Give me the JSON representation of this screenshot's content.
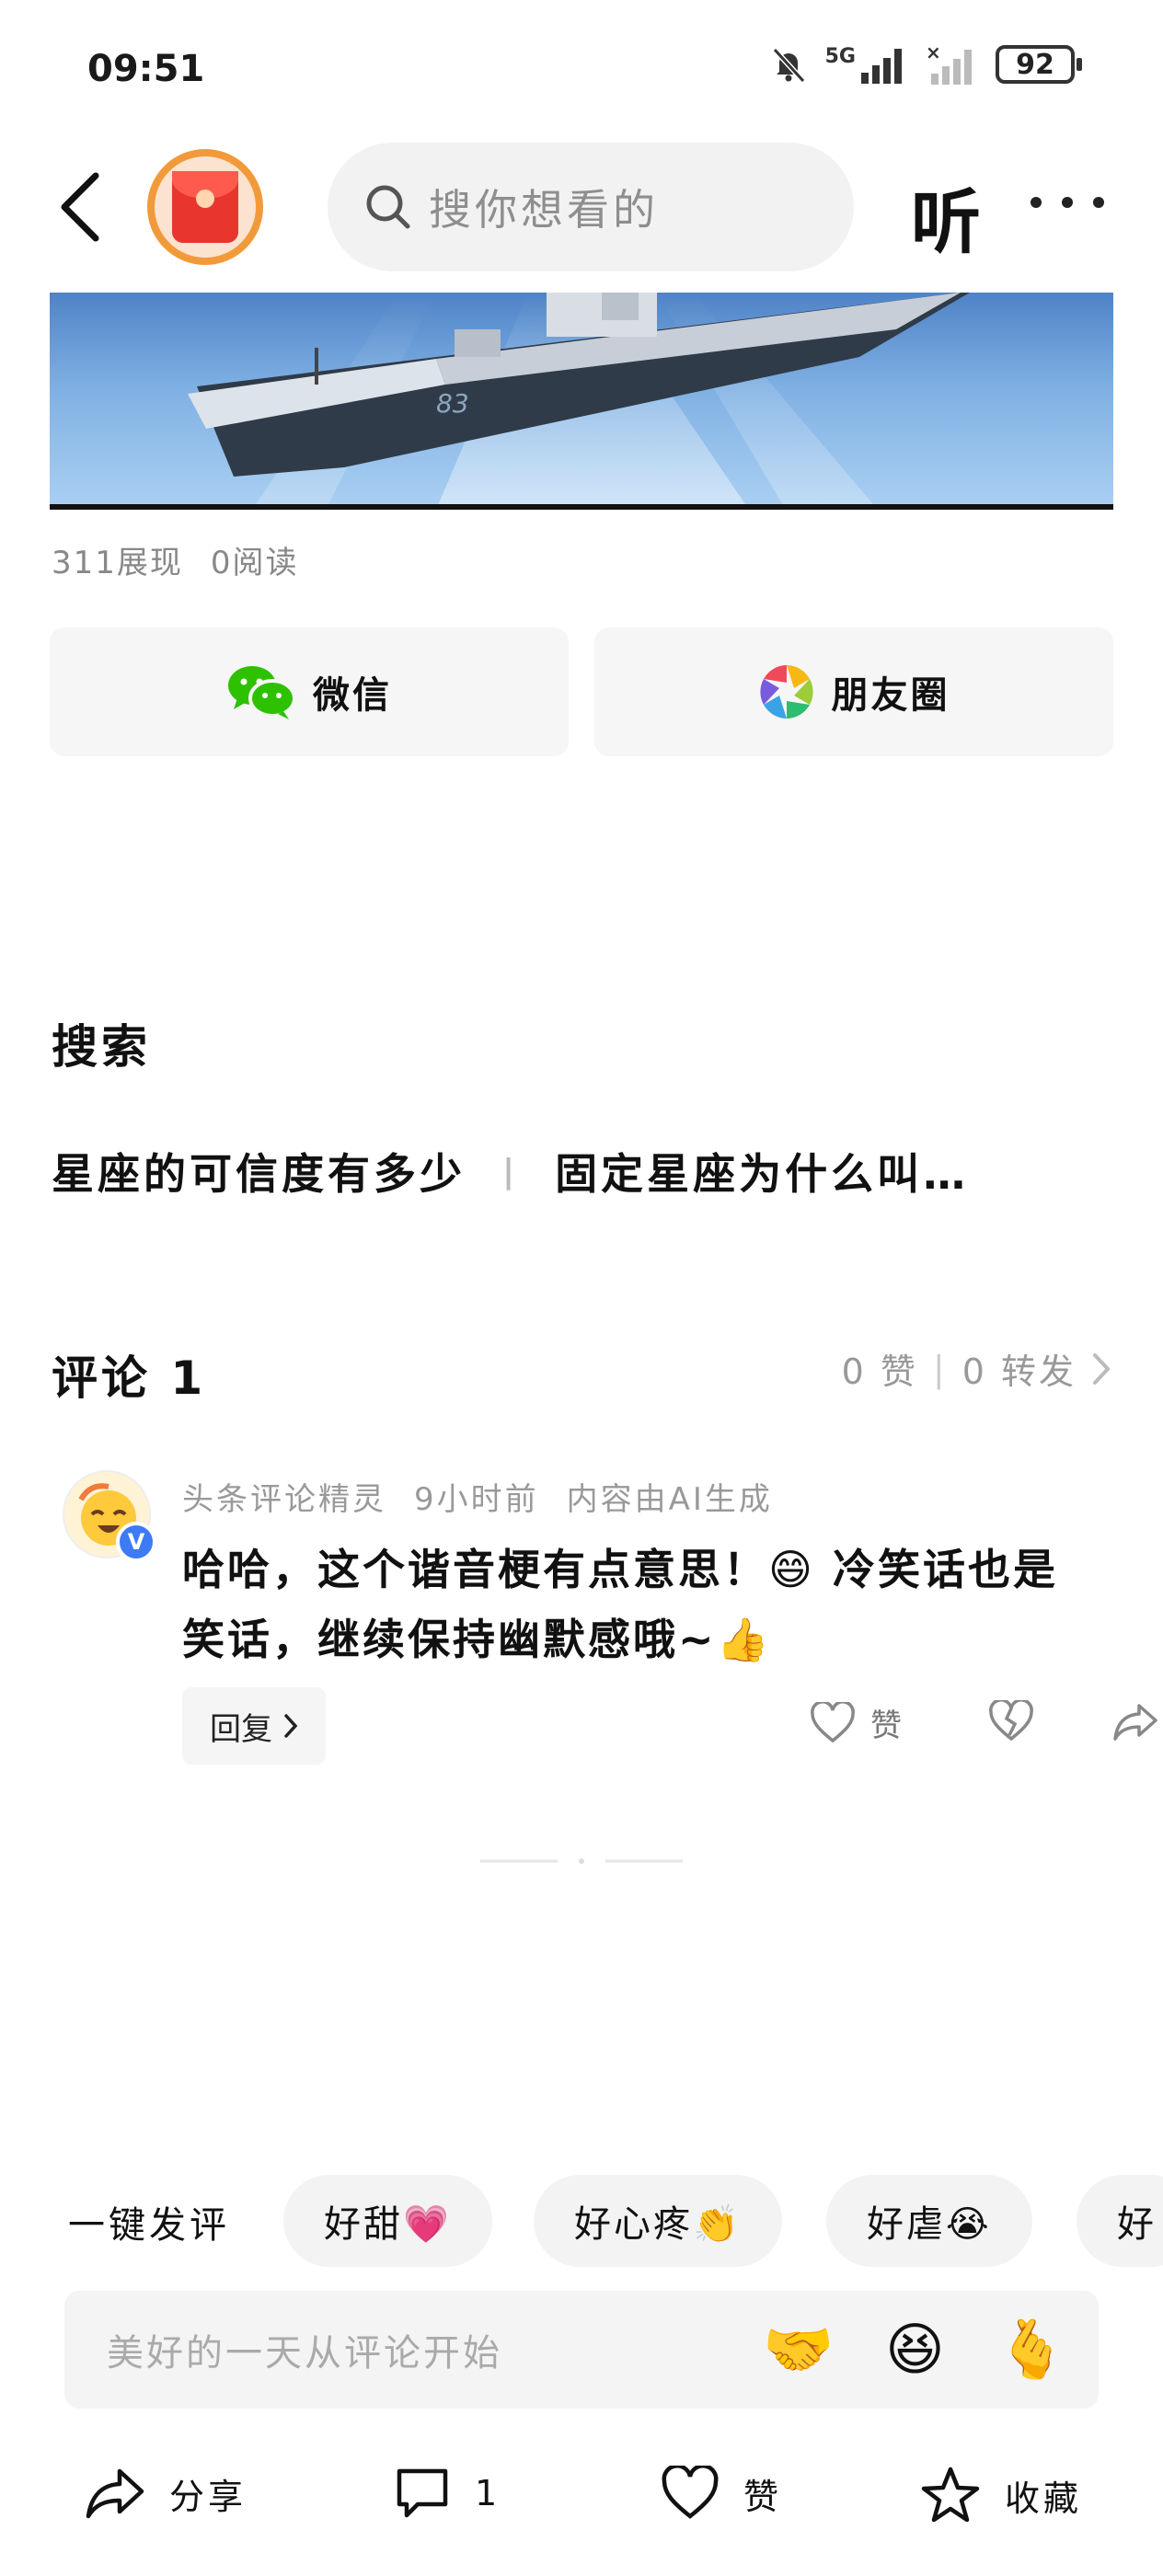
{
  "status": {
    "time": "09:51",
    "network": "5G",
    "battery": "92"
  },
  "header": {
    "search_placeholder": "搜你想看的",
    "listen_label": "听"
  },
  "article": {
    "impressions": "311展现",
    "reads": "0阅读"
  },
  "share": {
    "wechat_label": "微信",
    "moments_label": "朋友圈"
  },
  "search_section": {
    "title": "搜索",
    "links": [
      "星座的可信度有多少",
      "固定星座为什么叫…"
    ]
  },
  "comments_section": {
    "title": "评论 1",
    "likes": "0 赞",
    "reposts": "0 转发"
  },
  "comment": {
    "author": "头条评论精灵",
    "time": "9小时前",
    "ai_note": "内容由AI生成",
    "text": "哈哈，这个谐音梗有点意思！😄 冷笑话也是笑话，继续保持幽默感哦~👍",
    "reply_label": "回复",
    "like_label": "赞",
    "badge": "V"
  },
  "quick_reply": {
    "label": "一键发评",
    "chips": [
      "好甜💗",
      "好心疼👏",
      "好虐😭",
      "好"
    ]
  },
  "input": {
    "placeholder": "美好的一天从评论开始",
    "emojis": [
      "🤝",
      "😆",
      "🫰"
    ]
  },
  "bottom_bar": {
    "share_label": "分享",
    "comment_count": "1",
    "like_label": "赞",
    "favorite_label": "收藏"
  },
  "colors": {
    "wechat_green": "#2dc100",
    "badge_blue": "#3d7bf5",
    "redpacket_red": "#e8352e",
    "redpacket_ring": "#f29a3a"
  }
}
